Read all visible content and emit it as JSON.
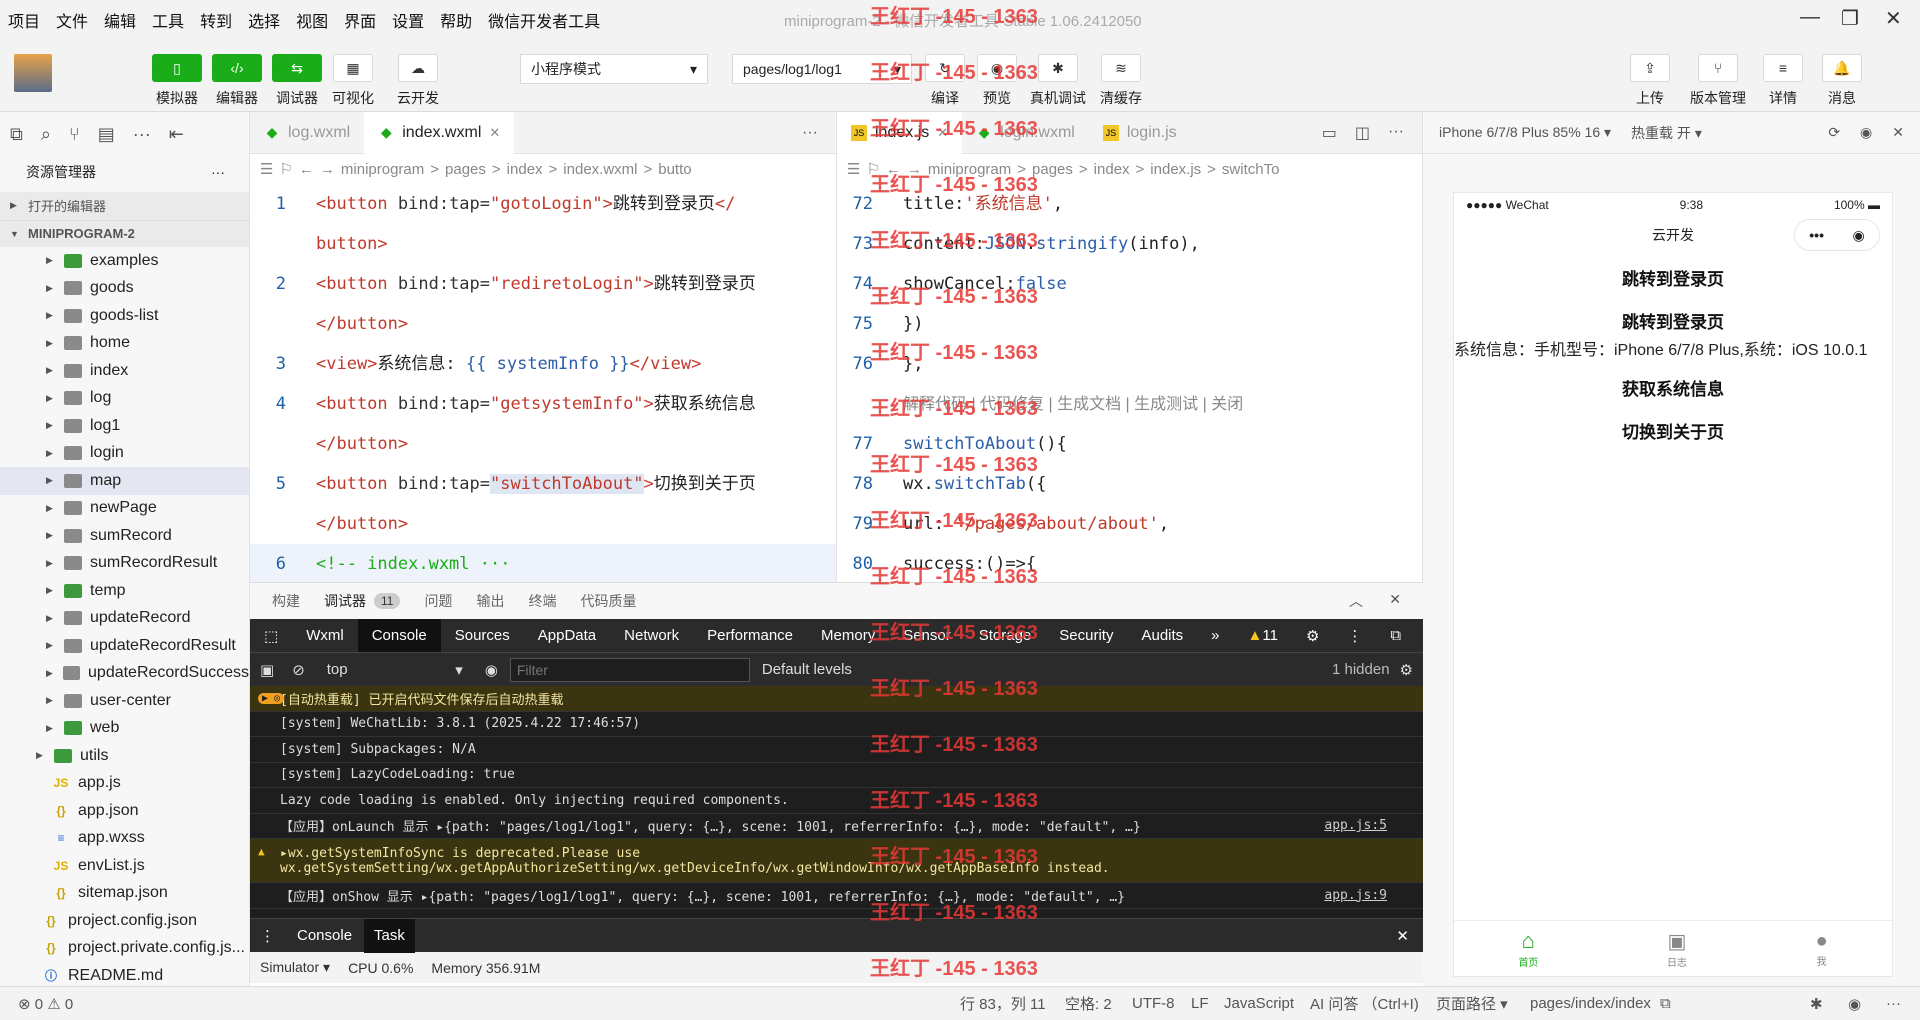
{
  "menu": [
    "项目",
    "文件",
    "编辑",
    "工具",
    "转到",
    "选择",
    "视图",
    "界面",
    "设置",
    "帮助",
    "微信开发者工具"
  ],
  "window_title": "miniprogram-2 - 微信开发者工具 Stable 1.06.2412050",
  "toolbar": {
    "simulator": "模拟器",
    "editor": "编辑器",
    "debugger": "调试器",
    "visual": "可视化",
    "cloud": "云开发",
    "mode": "小程序模式",
    "page": "pages/log1/log1",
    "compile": "编译",
    "preview": "预览",
    "realdebug": "真机调试",
    "clearcache": "清缓存",
    "upload": "上传",
    "version": "版本管理",
    "details": "详情",
    "messages": "消息"
  },
  "sidebar": {
    "title": "资源管理器",
    "open_editors": "打开的编辑器",
    "project": "MINIPROGRAM-2",
    "folders": [
      "examples",
      "goods",
      "goods-list",
      "home",
      "index",
      "log",
      "log1",
      "login",
      "map",
      "newPage",
      "sumRecord",
      "sumRecordResult",
      "temp",
      "updateRecord",
      "updateRecordResult",
      "updateRecordSuccess",
      "user-center",
      "web"
    ],
    "utils": "utils",
    "files": [
      "app.js",
      "app.json",
      "app.wxss",
      "envList.js",
      "sitemap.json"
    ],
    "root_files": [
      "project.config.json",
      "project.private.config.js...",
      "README.md"
    ]
  },
  "editor1": {
    "tabs": [
      "log.wxml",
      "index.wxml"
    ],
    "crumb": [
      "miniprogram",
      ">",
      "pages",
      ">",
      "index",
      ">",
      "index.wxml",
      ">",
      "butto"
    ],
    "lines": [
      {
        "n": "1",
        "parts": [
          [
            "tag",
            "<button "
          ],
          [
            "attr",
            "bind:tap="
          ],
          [
            "str",
            "\"gotoLogin\""
          ],
          [
            "tag",
            ">"
          ],
          [
            "txt",
            "跳转到登录页"
          ],
          [
            "tag",
            "</"
          ]
        ]
      },
      {
        "n": "",
        "parts": [
          [
            "tag",
            "button>"
          ]
        ]
      },
      {
        "n": "2",
        "parts": [
          [
            "tag",
            "<button "
          ],
          [
            "attr",
            "bind:tap="
          ],
          [
            "str",
            "\"rediretoLogin\""
          ],
          [
            "tag",
            ">"
          ],
          [
            "txt",
            "跳转到登录页"
          ]
        ]
      },
      {
        "n": "",
        "parts": [
          [
            "tag",
            "</button>"
          ]
        ]
      },
      {
        "n": "3",
        "parts": [
          [
            "tag",
            "<view>"
          ],
          [
            "txt",
            "系统信息: "
          ],
          [
            "kw",
            "{{ systemInfo }}"
          ],
          [
            "tag",
            "</view>"
          ]
        ]
      },
      {
        "n": "4",
        "parts": [
          [
            "tag",
            "<button "
          ],
          [
            "attr",
            "bind:tap="
          ],
          [
            "str",
            "\"getsystemInfo\""
          ],
          [
            "tag",
            ">"
          ],
          [
            "txt",
            "获取系统信息"
          ]
        ]
      },
      {
        "n": "",
        "parts": [
          [
            "tag",
            "</button>"
          ]
        ]
      },
      {
        "n": "5",
        "parts": [
          [
            "tag",
            "<button "
          ],
          [
            "attr",
            "bind:tap="
          ],
          [
            "str",
            "\"switchToAbout\""
          ],
          [
            "tag",
            ">"
          ],
          [
            "txt",
            "切换到关于页"
          ]
        ]
      },
      {
        "n": "",
        "parts": [
          [
            "tag",
            "</button>"
          ]
        ]
      },
      {
        "n": "6",
        "parts": [
          [
            "cm",
            "<!-- index.wxml ···"
          ]
        ]
      }
    ]
  },
  "editor2": {
    "tabs": [
      "index.js",
      "login.wxml",
      "login.js"
    ],
    "crumb": [
      "miniprogram",
      ">",
      "pages",
      ">",
      "index",
      ">",
      "index.js",
      ">",
      "switchTo"
    ],
    "lines": [
      {
        "n": "72",
        "parts": [
          [
            "txt",
            "    title:"
          ],
          [
            "str",
            "'系统信息'"
          ],
          [
            "txt",
            ","
          ]
        ]
      },
      {
        "n": "73",
        "parts": [
          [
            "txt",
            "    content:"
          ],
          [
            "kw",
            "JSON"
          ],
          [
            "txt",
            "."
          ],
          [
            "kw",
            "stringify"
          ],
          [
            "txt",
            "(info),"
          ]
        ]
      },
      {
        "n": "74",
        "parts": [
          [
            "txt",
            "    showCancel:"
          ],
          [
            "kw",
            "false"
          ]
        ]
      },
      {
        "n": "75",
        "parts": [
          [
            "txt",
            "  })"
          ]
        ]
      },
      {
        "n": "76",
        "parts": [
          [
            "txt",
            " },"
          ]
        ]
      },
      {
        "n": "",
        "parts": [
          [
            "cm2",
            "解释代码 | 代码修复 | 生成文档 | 生成测试 | 关闭"
          ]
        ]
      },
      {
        "n": "77",
        "parts": [
          [
            "kw",
            " switchToAbout"
          ],
          [
            "txt",
            "(){"
          ]
        ]
      },
      {
        "n": "78",
        "parts": [
          [
            "txt",
            "  wx."
          ],
          [
            "kw",
            "switchTab"
          ],
          [
            "txt",
            "({"
          ]
        ]
      },
      {
        "n": "79",
        "parts": [
          [
            "txt",
            "    url: "
          ],
          [
            "str",
            "'/pages/about/about'"
          ],
          [
            "txt",
            ","
          ]
        ]
      },
      {
        "n": "80",
        "parts": [
          [
            "txt",
            "    success:()=>{"
          ]
        ]
      }
    ]
  },
  "panel": {
    "tabs": [
      "构建",
      "调试器",
      "问题",
      "输出",
      "终端",
      "代码质量"
    ],
    "badge": "11",
    "devtools": [
      "Wxml",
      "Console",
      "Sources",
      "AppData",
      "Network",
      "Performance",
      "Memory",
      "Sensor",
      "Storage",
      "Security",
      "Audits"
    ],
    "warn_count": "11",
    "context": "top",
    "filter_placeholder": "Filter",
    "levels": "Default levels",
    "hidden": "1 hidden",
    "console": [
      {
        "t": "hot",
        "text": "[自动热重载] 已开启代码文件保存后自动热重载",
        "src": ""
      },
      {
        "t": "",
        "text": "[system] WeChatLib: 3.8.1 (2025.4.22 17:46:57)",
        "src": ""
      },
      {
        "t": "",
        "text": "[system] Subpackages: N/A",
        "src": ""
      },
      {
        "t": "",
        "text": "[system] LazyCodeLoading: true",
        "src": ""
      },
      {
        "t": "",
        "text": "Lazy code loading is enabled. Only injecting required components.",
        "src": ""
      },
      {
        "t": "",
        "text": "【应用】onLaunch 显示 ▸{path: \"pages/log1/log1\", query: {…}, scene: 1001, referrerInfo: {…}, mode: \"default\", …}",
        "src": "app.js:5"
      },
      {
        "t": "warn",
        "text": "▸wx.getSystemInfoSync is deprecated.Please use",
        "text2": "wx.getSystemSetting/wx.getAppAuthorizeSetting/wx.getDeviceInfo/wx.getWindowInfo/wx.getAppBaseInfo instead.",
        "src": ""
      },
      {
        "t": "",
        "text": "【应用】onShow 显示 ▸{path: \"pages/log1/log1\", query: {…}, scene: 1001, referrerInfo: {…}, mode: \"default\", …}",
        "src": "app.js:9"
      }
    ],
    "drawer": [
      "Console",
      "Task"
    ],
    "sim_label": "Simulator",
    "cpu": "CPU 0.6%",
    "mem": "Memory 356.91M"
  },
  "simulator": {
    "device": "iPhone 6/7/8 Plus 85% 16",
    "reload": "热重载 开",
    "carrier": "●●●●● WeChat",
    "time": "9:38",
    "battery": "100%",
    "nav_title": "云开发",
    "buttons": [
      "跳转到登录页",
      "跳转到登录页"
    ],
    "sysinfo": "系统信息：手机型号：iPhone 6/7/8 Plus,系统：iOS 10.0.1",
    "buttons2": [
      "获取系统信息",
      "切换到关于页"
    ],
    "tabbar": [
      "首页",
      "日志",
      "我"
    ]
  },
  "status": {
    "errors": "0",
    "warnings": "0",
    "position": "行 83，列 11",
    "spaces": "空格: 2",
    "encoding": "UTF-8",
    "eol": "LF",
    "lang": "JavaScript",
    "ai": "AI 问答 （Ctrl+I)",
    "page_path_label": "页面路径",
    "page_path": "pages/index/index"
  },
  "watermark": "王红丁 -145 - 1363"
}
